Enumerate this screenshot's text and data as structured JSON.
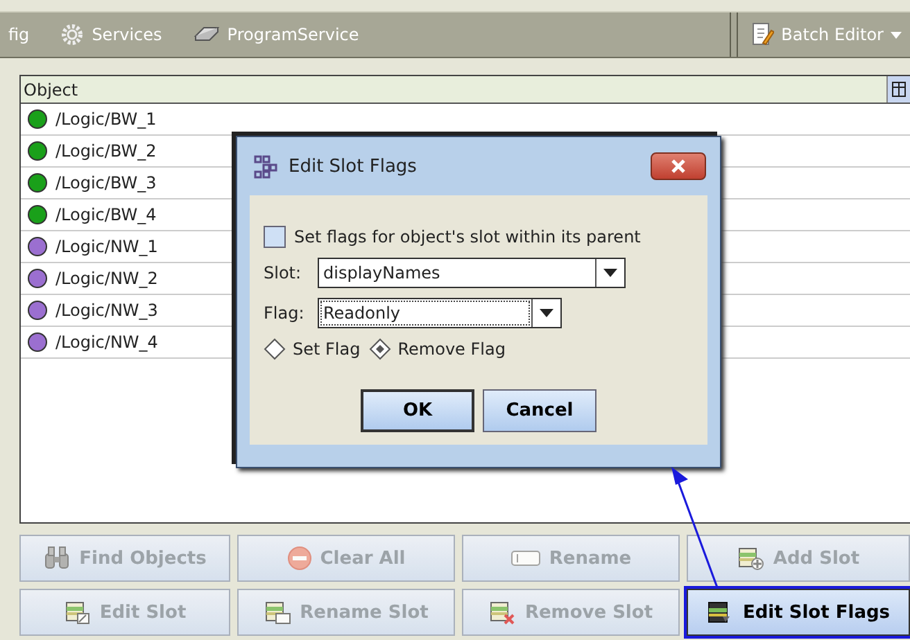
{
  "toolbar": {
    "items": [
      {
        "kind": "text",
        "label": "fig"
      },
      {
        "kind": "gear",
        "label": "Services"
      },
      {
        "kind": "program",
        "label": "ProgramService"
      }
    ],
    "batch_editor": "Batch Editor"
  },
  "table": {
    "columns": [
      "Object"
    ],
    "rows": [
      {
        "name": "/Logic/BW_1",
        "color": "#1aa01a"
      },
      {
        "name": "/Logic/BW_2",
        "color": "#1aa01a"
      },
      {
        "name": "/Logic/BW_3",
        "color": "#1aa01a"
      },
      {
        "name": "/Logic/BW_4",
        "color": "#1aa01a"
      },
      {
        "name": "/Logic/NW_1",
        "color": "#9b6fd0"
      },
      {
        "name": "/Logic/NW_2",
        "color": "#9b6fd0"
      },
      {
        "name": "/Logic/NW_3",
        "color": "#9b6fd0"
      },
      {
        "name": "/Logic/NW_4",
        "color": "#9b6fd0"
      }
    ]
  },
  "dialog": {
    "title": "Edit Slot Flags",
    "checkbox": {
      "label": "Set flags for object's slot within its parent",
      "checked": false
    },
    "slot": {
      "label": "Slot:",
      "value": "displayNames"
    },
    "flag": {
      "label": "Flag:",
      "value": "Readonly"
    },
    "radios": [
      {
        "label": "Set Flag",
        "selected": false
      },
      {
        "label": "Remove Flag",
        "selected": true
      }
    ],
    "buttons": [
      "OK",
      "Cancel"
    ]
  },
  "buttons": [
    {
      "label": "Find Objects",
      "kind": "binoculars",
      "disabled": true,
      "highlighted": false
    },
    {
      "label": "Clear All",
      "kind": "clear",
      "disabled": true,
      "highlighted": false
    },
    {
      "label": "Rename",
      "kind": "rename",
      "disabled": true,
      "highlighted": false
    },
    {
      "label": "Add Slot",
      "kind": "add",
      "disabled": true,
      "highlighted": false
    },
    {
      "label": "Edit Slot",
      "kind": "edit",
      "disabled": true,
      "highlighted": false
    },
    {
      "label": "Rename Slot",
      "kind": "renameslot",
      "disabled": true,
      "highlighted": false
    },
    {
      "label": "Remove Slot",
      "kind": "remove",
      "disabled": true,
      "highlighted": false
    },
    {
      "label": "Edit Slot Flags",
      "kind": "flags",
      "disabled": false,
      "highlighted": true
    }
  ]
}
